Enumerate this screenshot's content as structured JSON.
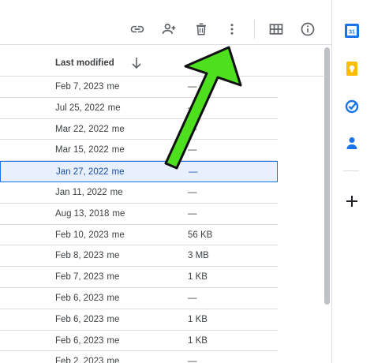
{
  "toolbar": {
    "icons": [
      "link-icon",
      "add-person-icon",
      "trash-icon",
      "more-vert-icon",
      "grid-view-icon",
      "info-icon"
    ]
  },
  "header": {
    "last_modified_label": "Last modified"
  },
  "files": [
    {
      "modified": "Feb 7, 2023",
      "owner": "me",
      "size": "—"
    },
    {
      "modified": "Jul 25, 2022",
      "owner": "me",
      "size": "—"
    },
    {
      "modified": "Mar 22, 2022",
      "owner": "me",
      "size": "—"
    },
    {
      "modified": "Mar 15, 2022",
      "owner": "me",
      "size": "—"
    },
    {
      "modified": "Jan 27, 2022",
      "owner": "me",
      "size": "—",
      "selected": true
    },
    {
      "modified": "Jan 11, 2022",
      "owner": "me",
      "size": "—"
    },
    {
      "modified": "Aug 13, 2018",
      "owner": "me",
      "size": "—"
    },
    {
      "modified": "Feb 10, 2023",
      "owner": "me",
      "size": "56 KB"
    },
    {
      "modified": "Feb 8, 2023",
      "owner": "me",
      "size": "3 MB"
    },
    {
      "modified": "Feb 7, 2023",
      "owner": "me",
      "size": "1 KB"
    },
    {
      "modified": "Feb 6, 2023",
      "owner": "me",
      "size": "—"
    },
    {
      "modified": "Feb 6, 2023",
      "owner": "me",
      "size": "1 KB"
    },
    {
      "modified": "Feb 6, 2023",
      "owner": "me",
      "size": "1 KB"
    },
    {
      "modified": "Feb 2, 2023",
      "owner": "me",
      "size": "—"
    }
  ],
  "side_panel": {
    "apps": [
      "calendar-icon",
      "keep-icon",
      "tasks-icon",
      "contacts-icon",
      "add-icon"
    ],
    "calendar_day": "31"
  },
  "colors": {
    "accent": "#1a73e8",
    "selected_bg": "#e8f0fe",
    "annotation_arrow": "#4ee01e"
  }
}
